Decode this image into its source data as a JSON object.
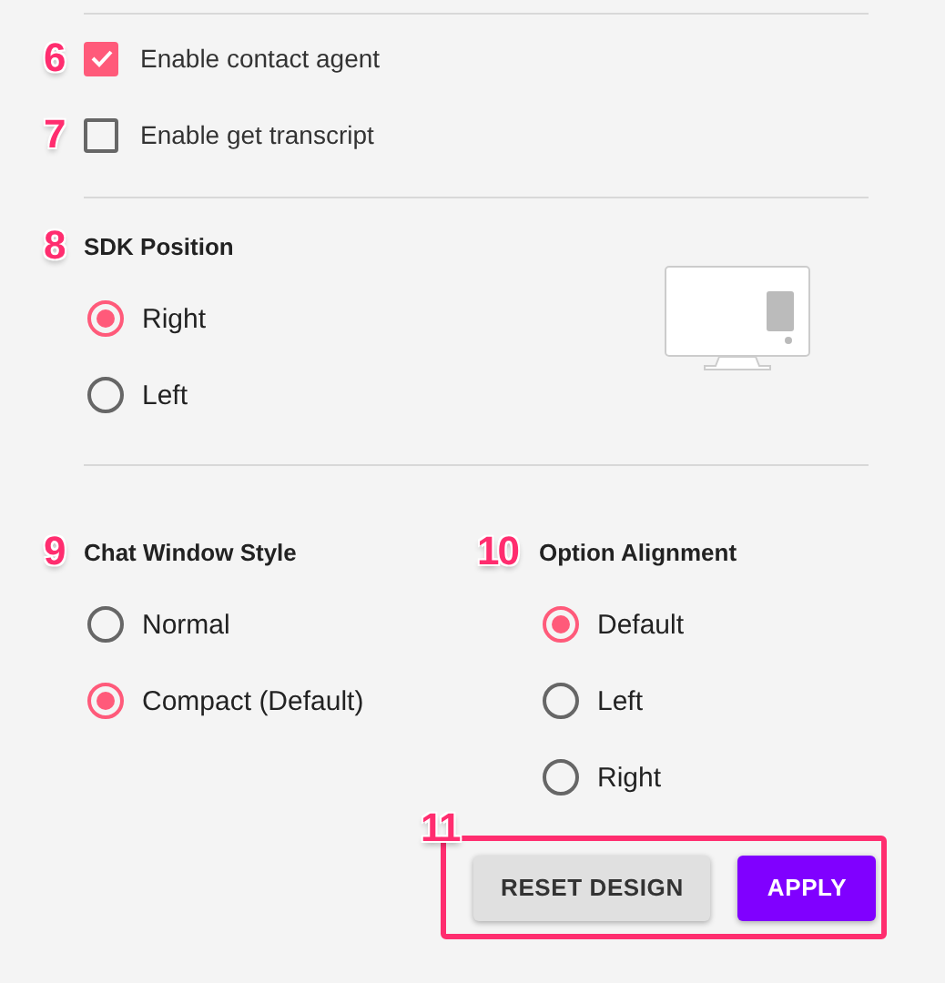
{
  "checkboxes": [
    {
      "callout": "6",
      "label": "Enable contact agent",
      "checked": true
    },
    {
      "callout": "7",
      "label": "Enable get transcript",
      "checked": false
    }
  ],
  "sdk_position": {
    "callout": "8",
    "title": "SDK Position",
    "options": [
      {
        "label": "Right",
        "selected": true
      },
      {
        "label": "Left",
        "selected": false
      }
    ]
  },
  "chat_window_style": {
    "callout": "9",
    "title": "Chat Window Style",
    "options": [
      {
        "label": "Normal",
        "selected": false
      },
      {
        "label": "Compact (Default)",
        "selected": true
      }
    ]
  },
  "option_alignment": {
    "callout": "10",
    "title": "Option Alignment",
    "options": [
      {
        "label": "Default",
        "selected": true
      },
      {
        "label": "Left",
        "selected": false
      },
      {
        "label": "Right",
        "selected": false
      }
    ]
  },
  "actions": {
    "callout": "11",
    "buttons": [
      {
        "label": "RESET DESIGN",
        "kind": "secondary"
      },
      {
        "label": "APPLY",
        "kind": "primary"
      }
    ]
  }
}
